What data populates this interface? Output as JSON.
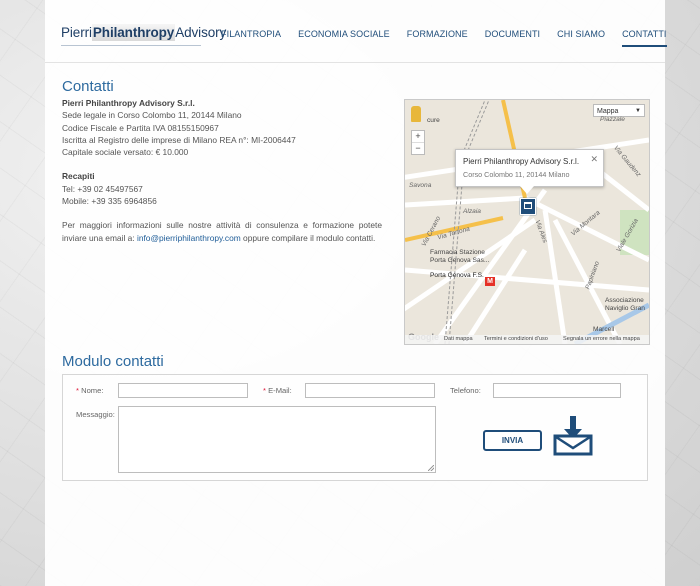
{
  "header": {
    "logo": {
      "part1": "Pierri",
      "part2": "Philanthropy",
      "part3": "Advisory"
    },
    "nav": [
      {
        "label": "FILANTROPIA"
      },
      {
        "label": "ECONOMIA SOCIALE"
      },
      {
        "label": "FORMAZIONE"
      },
      {
        "label": "DOCUMENTI"
      },
      {
        "label": "CHI SIAMO"
      },
      {
        "label": "CONTATTI",
        "active": true
      }
    ]
  },
  "contact": {
    "title": "Contatti",
    "company": "Pierri Philanthropy Advisory S.r.l.",
    "lines": [
      "Sede legale in Corso Colombo 11, 20144 Milano",
      "Codice Fiscale e Partita IVA 08155150967",
      "Iscritta al Registro delle imprese di Milano REA n°: MI-2006447",
      "Capitale sociale versato: € 10.000"
    ],
    "recapiti_title": "Recapiti",
    "tel": "Tel: +39 02 45497567",
    "mobile": "Mobile: +39 335 6964856",
    "desc_before": "Per maggiori informazioni sulle nostre attività di consulenza e formazione potete inviare una email a: ",
    "email": "info@pierriphilanthropy.com",
    "desc_after": " oppure compilare il modulo contatti."
  },
  "map": {
    "type_select": "Mappa",
    "zoom_in": "+",
    "zoom_out": "−",
    "info_name": "Pierri Philanthropy Advisory S.r.l.",
    "info_address": "Corso Colombo 11, 20144 Milano",
    "info_close": "✕",
    "labels": {
      "cure": "cure",
      "piazzale": "Piazzale",
      "via_gaudenzio": "Via Gaudenz",
      "savona": "Savona",
      "alzaia": "Alzaia",
      "tortona": "Via Tortona",
      "cerano": "Via Cerano",
      "via_ales": "Via Ales",
      "via_montara": "Via Montara",
      "gorizia": "Viale Gorizia",
      "papiniano": "Papiniano",
      "farmacia1": "Farmacia Stazione",
      "farmacia2": "Porta Genova Sas...",
      "portagenova": "Porta Genova F.S.",
      "metro": "M",
      "assoc1": "Associazione",
      "assoc2": "Naviglio Gran",
      "marcello": "Marcell",
      "google": "Google"
    },
    "footer": {
      "data": "Dati mappa",
      "terms": "Termini e condizioni d'uso",
      "report": "Segnala un errore nella mappa"
    }
  },
  "form": {
    "title": "Modulo contatti",
    "req_mark": "*",
    "name_label": "Nome:",
    "email_label": "E-Mail:",
    "phone_label": "Telefono:",
    "message_label": "Messaggio:",
    "send_label": "INVIA"
  },
  "colors": {
    "brand": "#1f4d7a",
    "title": "#2d6a9f",
    "metro": "#e53026"
  }
}
